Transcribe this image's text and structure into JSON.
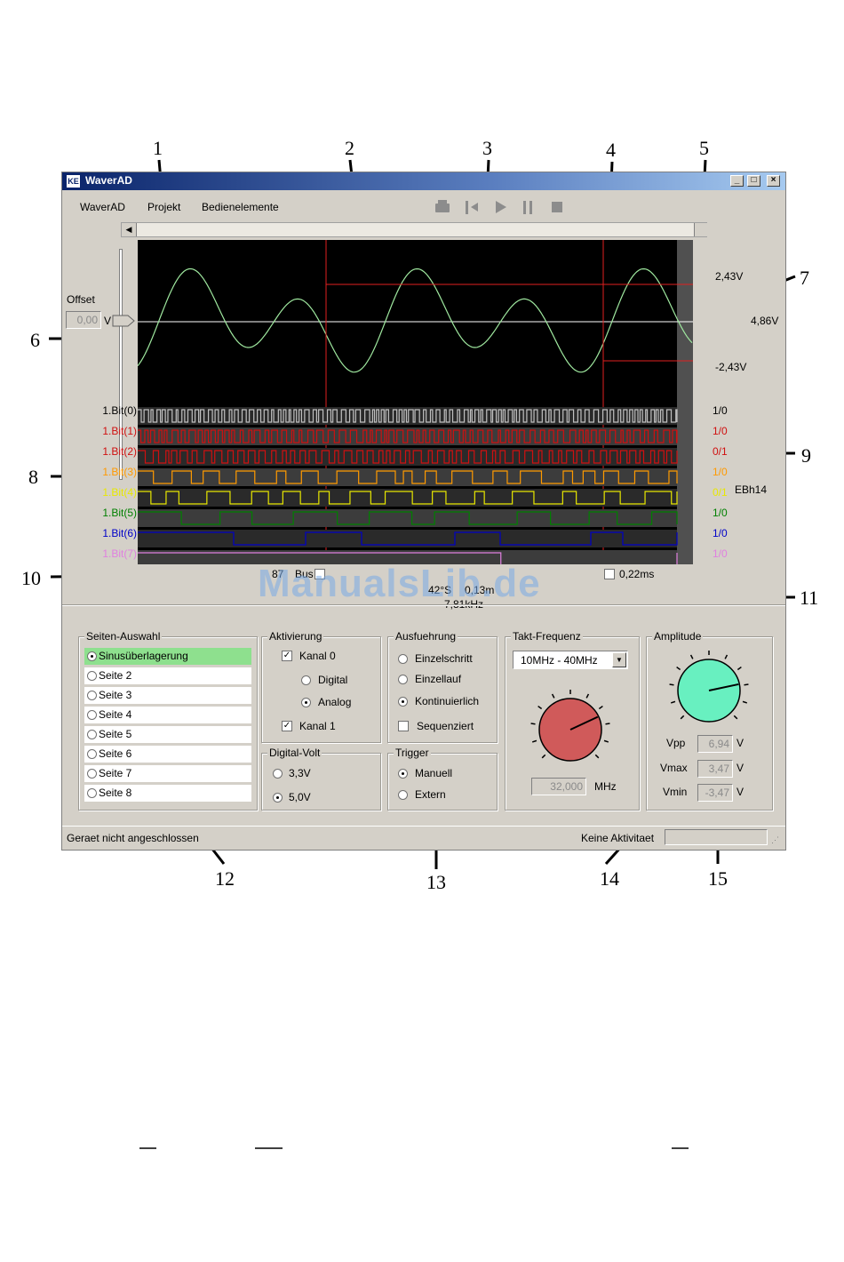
{
  "window": {
    "title": "WaverAD",
    "icon": "app-icon",
    "min": "_",
    "max": "□",
    "close": "×"
  },
  "menu": [
    "WaverAD",
    "Projekt",
    "Bedienelemente"
  ],
  "toolbar": {
    "icons": [
      "print-icon",
      "step-to-start-icon",
      "play-icon",
      "pause-icon",
      "stop-icon"
    ]
  },
  "scope": {
    "offset_label": "Offset",
    "offset_value": "0,00",
    "offset_unit": "V",
    "cursor_upper": "2,43V",
    "cursor_lower": "-2,43V",
    "cursor_diff": "4,86V",
    "hex_value": "EBh14",
    "bits": [
      {
        "label": "1.Bit(0)",
        "value": "1/0",
        "color": "#000000"
      },
      {
        "label": "1.Bit(1)",
        "value": "1/0",
        "color": "#d01010"
      },
      {
        "label": "1.Bit(2)",
        "value": "0/1",
        "color": "#d01010"
      },
      {
        "label": "1.Bit(3)",
        "value": "1/0",
        "color": "#ff9a00"
      },
      {
        "label": "1.Bit(4)",
        "value": "0/1",
        "color": "#e8e800"
      },
      {
        "label": "1.Bit(5)",
        "value": "1/0",
        "color": "#008000"
      },
      {
        "label": "1.Bit(6)",
        "value": "1/0",
        "color": "#0000c8"
      },
      {
        "label": "1.Bit(7)",
        "value": "1/0",
        "color": "#e080e0"
      }
    ],
    "bus_count": "87",
    "bus_label": "Bus",
    "time_cursor": "0,22ms",
    "pos_value": "42°S",
    "time_value": "0,13m",
    "freq_value": "7,81kHz"
  },
  "pages": {
    "title": "Seiten-Auswahl",
    "items": [
      "Sinusüberlagerung",
      "Seite 2",
      "Seite 3",
      "Seite 4",
      "Seite 5",
      "Seite 6",
      "Seite 7",
      "Seite 8"
    ],
    "selected": 0
  },
  "aktivierung": {
    "title": "Aktivierung",
    "kanal0": "Kanal 0",
    "digital": "Digital",
    "analog": "Analog",
    "kanal1": "Kanal 1"
  },
  "ausfuehrung": {
    "title": "Ausfuehrung",
    "einzelschritt": "Einzelschritt",
    "einzellauf": "Einzellauf",
    "kontinuierlich": "Kontinuierlich",
    "sequenziert": "Sequenziert"
  },
  "digitalvolt": {
    "title": "Digital-Volt",
    "v33": "3,3V",
    "v50": "5,0V"
  },
  "trigger": {
    "title": "Trigger",
    "manuell": "Manuell",
    "extern": "Extern"
  },
  "takt": {
    "title": "Takt-Frequenz",
    "range": "10MHz - 40MHz",
    "value": "32,000",
    "unit": "MHz",
    "knob_color": "#d05a5a"
  },
  "amplitude": {
    "title": "Amplitude",
    "knob_color": "#68f0c0",
    "vpp_label": "Vpp",
    "vpp": "6,94",
    "vmax_label": "Vmax",
    "vmax": "3,47",
    "vmin_label": "Vmin",
    "vmin": "-3,47",
    "unit": "V"
  },
  "status": {
    "left": "Geraet nicht angeschlossen",
    "right": "Keine Aktivitaet"
  },
  "callouts": [
    "1",
    "2",
    "3",
    "4",
    "5",
    "6",
    "7",
    "8",
    "9",
    "10",
    "11",
    "12",
    "13",
    "14",
    "15"
  ],
  "watermark": "ManualsLib.de"
}
